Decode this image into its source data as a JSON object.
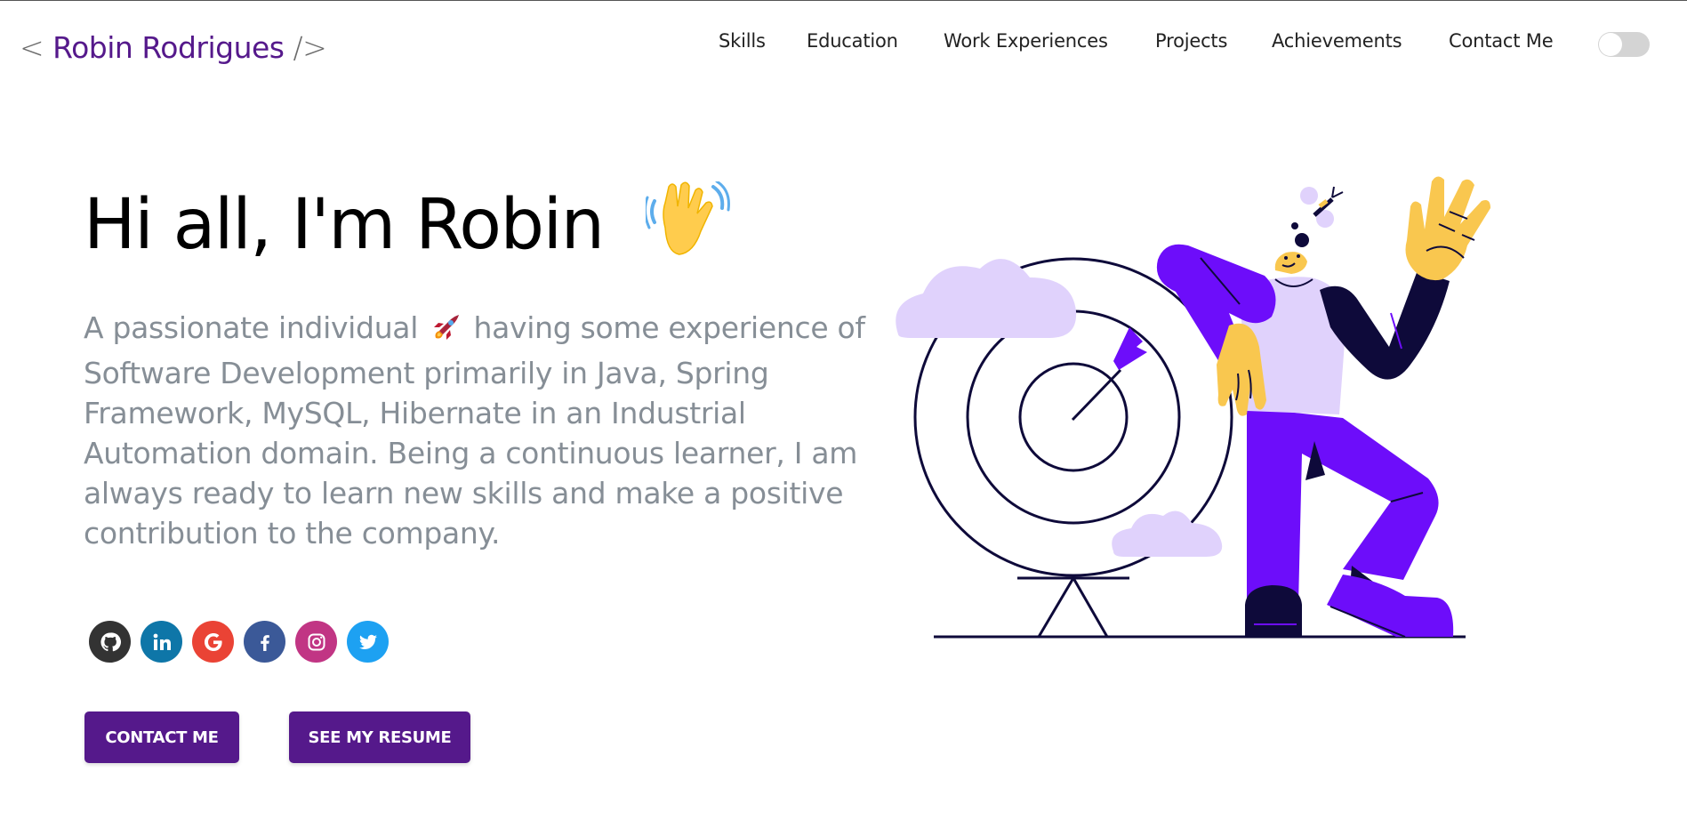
{
  "header": {
    "logo_open": "<",
    "logo_name": "Robin Rodrigues",
    "logo_close": "/>",
    "nav": [
      {
        "label": "Skills"
      },
      {
        "label": "Education"
      },
      {
        "label": "Work Experiences"
      },
      {
        "label": "Projects"
      },
      {
        "label": "Achievements"
      },
      {
        "label": "Contact Me"
      }
    ],
    "theme_toggle": {
      "icon": "toggle-switch",
      "state": "off"
    }
  },
  "hero": {
    "greeting": "Hi all, I'm Robin",
    "greeting_emoji": "waving-hand",
    "subtitle_before": "A passionate individual",
    "subtitle_emoji": "rocket",
    "subtitle_after": "having some experience of Software Development primarily in Java, Spring Framework, MySQL, Hibernate in an Industrial Automation domain. Being a continuous learner, I am always ready to learn new skills and make a positive contribution to the company."
  },
  "socials": [
    {
      "name": "github",
      "icon": "github-icon",
      "color": "#333333"
    },
    {
      "name": "linkedin",
      "icon": "linkedin-icon",
      "color": "#0e76a8"
    },
    {
      "name": "google",
      "icon": "google-icon",
      "color": "#ea4335"
    },
    {
      "name": "facebook",
      "icon": "facebook-icon",
      "color": "#3b5998"
    },
    {
      "name": "instagram",
      "icon": "instagram-icon",
      "color": "#c13584"
    },
    {
      "name": "twitter",
      "icon": "twitter-icon",
      "color": "#1da1f2"
    }
  ],
  "buttons": {
    "contact": "CONTACT ME",
    "resume": "SEE MY RESUME"
  },
  "colors": {
    "accent": "#55198b",
    "subtitle": "#868e96",
    "illustration_purple": "#6d0dfa",
    "illustration_lavender": "#e0d2fc",
    "illustration_yellow": "#f9c74f"
  }
}
